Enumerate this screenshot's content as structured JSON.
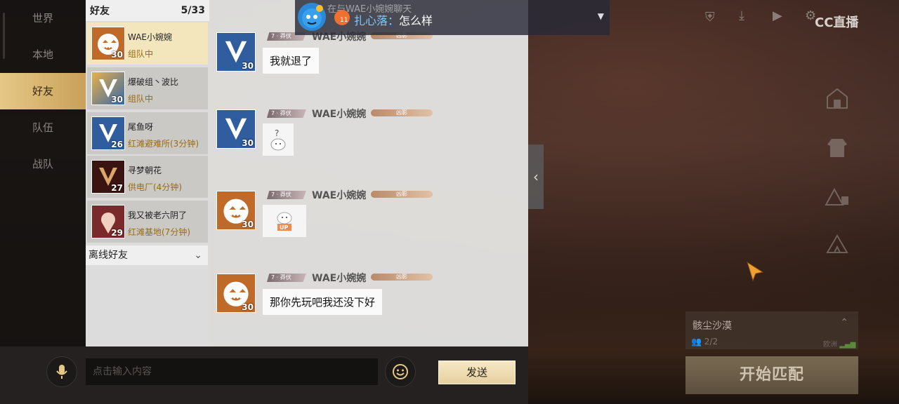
{
  "nav": {
    "items": [
      "世界",
      "本地",
      "好友",
      "队伍",
      "战队"
    ],
    "active_index": 2
  },
  "friends": {
    "title": "好友",
    "count": "5/33",
    "list": [
      {
        "name": "WAE小婉婉",
        "status": "组队中",
        "level": "30",
        "avatar": "pumpkin-avatar",
        "active": true
      },
      {
        "name": "爆破组丶波比",
        "status": "组队中",
        "level": "30",
        "avatar": "v-emblem-gold-avatar",
        "active": false
      },
      {
        "name": "尾鱼呀",
        "status": "红滩避难所(3分钟)",
        "level": "26",
        "avatar": "v-emblem-blue-avatar",
        "active": false
      },
      {
        "name": "寻梦朝花",
        "status": "供电厂(4分钟)",
        "level": "27",
        "avatar": "v-emblem-dark-avatar",
        "active": false
      },
      {
        "name": "我又被老六阴了",
        "status": "红滩基地(7分钟)",
        "level": "29",
        "avatar": "flower-avatar",
        "active": false
      }
    ],
    "offline_label": "离线好友"
  },
  "chat": {
    "messages": [
      {
        "avatar": "v-emblem-blue-avatar",
        "level": "30",
        "badge": "7 · 莽伏",
        "username": "WAE小婉婉",
        "tag": "凶影",
        "text": "我就退了",
        "sticker": null
      },
      {
        "avatar": "v-emblem-blue-avatar",
        "level": "30",
        "badge": "7 · 莽伏",
        "username": "WAE小婉婉",
        "tag": "凶影",
        "text": null,
        "sticker": "question-cat-sticker"
      },
      {
        "avatar": "pumpkin-avatar",
        "level": "30",
        "badge": "7 · 莽伏",
        "username": "WAE小婉婉",
        "tag": "凶影",
        "text": null,
        "sticker": "up-cat-sticker"
      },
      {
        "avatar": "pumpkin-avatar",
        "level": "30",
        "badge": "7 · 莽伏",
        "username": "WAE小婉婉",
        "tag": "凶影",
        "text": "那你先玩吧我还没下好",
        "sticker": null
      }
    ]
  },
  "banner": {
    "title": "在与WAE小婉婉聊天",
    "sender": "扎心落",
    "separator": "：",
    "message": "怎么样",
    "badge_number": "11"
  },
  "input": {
    "placeholder": "点击输入内容",
    "send_label": "发送"
  },
  "hud": {
    "logo_text": "CC直播",
    "map_name": "骸尘沙漠",
    "player_count": "2/2",
    "region": "欧洲",
    "match_label": "开始匹配"
  },
  "colors": {
    "accent_gold": "#e6c886",
    "status_gold": "#9a6a12",
    "sender_blue": "#7fc8ff"
  }
}
